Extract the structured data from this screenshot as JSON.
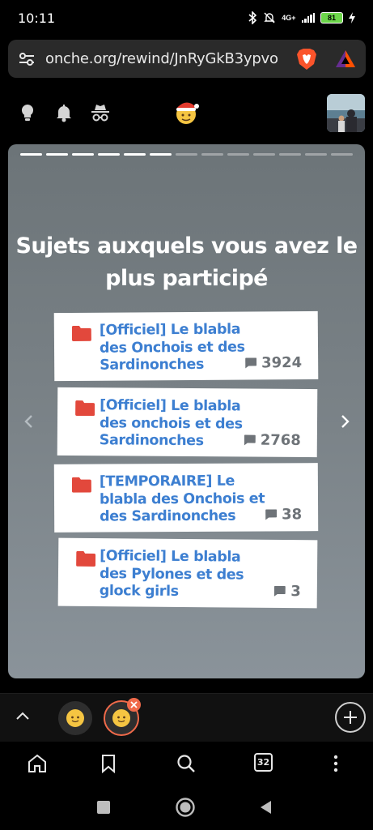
{
  "status_bar": {
    "time": "10:11",
    "network": "4G+",
    "battery": "81"
  },
  "url_bar": {
    "url": "onche.org/rewind/JnRyGkB3ypvo"
  },
  "story": {
    "progress_total": 13,
    "progress_done": 6,
    "title": "Sujets auxquels vous avez le plus participé",
    "topics": [
      {
        "name": "[Officiel] Le blabla des Onchois et des Sardinonches",
        "count": "3924"
      },
      {
        "name": "[Officiel] Le blabla des onchois et des Sardinonches",
        "count": "2768"
      },
      {
        "name": "[TEMPORAIRE] Le blabla des Onchois et des Sardinonches",
        "count": "38"
      },
      {
        "name": "[Officiel] Le blabla des Pylones et des glock girls",
        "count": "3"
      }
    ]
  },
  "toolbar": {
    "tab_count": "32"
  },
  "colors": {
    "accent": "#3d7fd1",
    "folder": "#e2483c",
    "tab_active_ring": "#f06a4a",
    "battery": "#6cd64a"
  },
  "icons": [
    "bulb-icon",
    "bell-icon",
    "incognito-icon",
    "home-icon",
    "bookmark-icon",
    "search-icon",
    "menu-icon"
  ]
}
